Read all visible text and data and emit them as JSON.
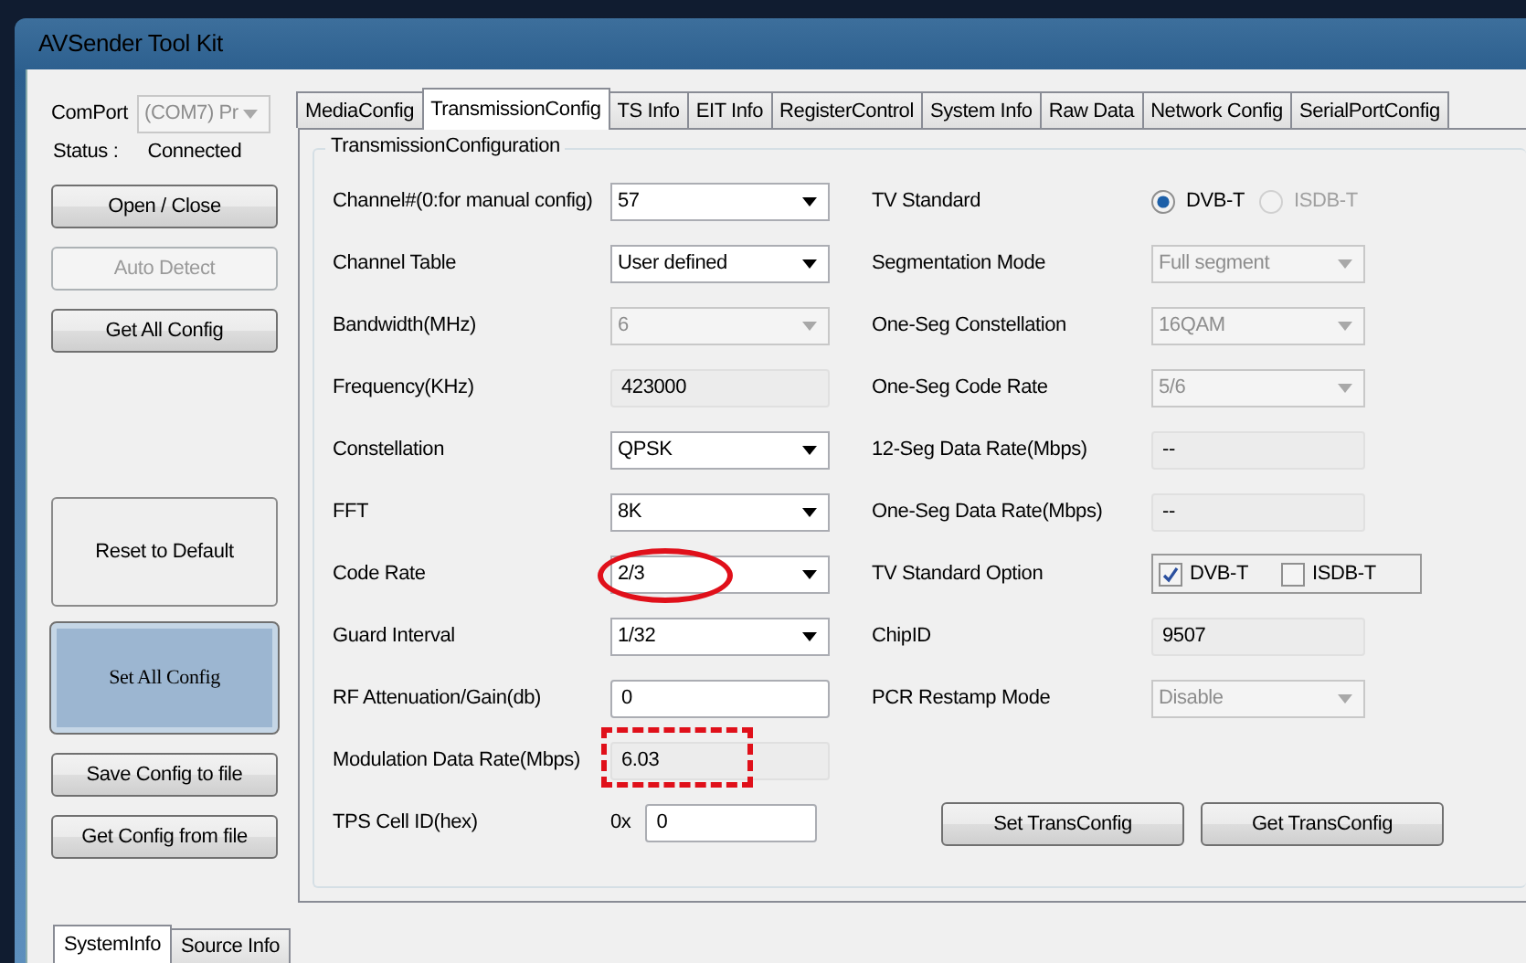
{
  "window": {
    "title": "AVSender Tool Kit"
  },
  "left_panel": {
    "comport_label": "ComPort",
    "comport_value": "(COM7) Pr",
    "comport_disabled": true,
    "status_label": "Status :",
    "status_value": "Connected",
    "buttons": [
      {
        "label": "Open / Close",
        "kind": "normal",
        "disabled": false,
        "highlighted": false
      },
      {
        "label": "Auto Detect",
        "kind": "normal",
        "disabled": true,
        "highlighted": false
      },
      {
        "label": "Get All Config",
        "kind": "normal",
        "disabled": false,
        "highlighted": false
      },
      {
        "label": "Reset to Default",
        "kind": "tall",
        "disabled": false,
        "highlighted": false
      },
      {
        "label": "Set All Config",
        "kind": "tall",
        "disabled": false,
        "highlighted": true
      },
      {
        "label": "Save Config to file",
        "kind": "normal",
        "disabled": false,
        "highlighted": false
      },
      {
        "label": "Get Config from file",
        "kind": "normal",
        "disabled": false,
        "highlighted": false
      }
    ]
  },
  "tabs": [
    {
      "label": "MediaConfig",
      "selected": false
    },
    {
      "label": "TransmissionConfig",
      "selected": true
    },
    {
      "label": "TS Info",
      "selected": false
    },
    {
      "label": "EIT Info",
      "selected": false
    },
    {
      "label": "RegisterControl",
      "selected": false
    },
    {
      "label": "System Info",
      "selected": false
    },
    {
      "label": "Raw Data",
      "selected": false
    },
    {
      "label": "Network Config",
      "selected": false
    },
    {
      "label": "SerialPortConfig",
      "selected": false
    }
  ],
  "group": {
    "title": "TransmissionConfiguration",
    "left_rows": [
      {
        "label": "Channel#(0:for manual config)",
        "kind": "dropdown",
        "value": "57",
        "disabled": false
      },
      {
        "label": "Channel Table",
        "kind": "dropdown",
        "value": "User defined",
        "disabled": false
      },
      {
        "label": "Bandwidth(MHz)",
        "kind": "dropdown",
        "value": "6",
        "disabled": true
      },
      {
        "label": "Frequency(KHz)",
        "kind": "text",
        "value": "423000",
        "disabled": true
      },
      {
        "label": "Constellation",
        "kind": "dropdown",
        "value": "QPSK",
        "disabled": false
      },
      {
        "label": "FFT",
        "kind": "dropdown",
        "value": "8K",
        "disabled": false
      },
      {
        "label": "Code Rate",
        "kind": "dropdown",
        "value": "2/3",
        "disabled": false,
        "circled": true
      },
      {
        "label": "Guard Interval",
        "kind": "dropdown",
        "value": "1/32",
        "disabled": false
      },
      {
        "label": "RF Attenuation/Gain(db)",
        "kind": "text",
        "value": "0",
        "disabled": false
      },
      {
        "label": "Modulation Data Rate(Mbps)",
        "kind": "text",
        "value": "6.03",
        "disabled": true,
        "dash_boxed": true
      },
      {
        "label": "TPS Cell ID(hex)",
        "kind": "prefixed",
        "prefix": "0x",
        "value": "0",
        "disabled": false
      }
    ],
    "right_rows": [
      {
        "label": "TV Standard",
        "kind": "radio",
        "options": [
          {
            "label": "DVB-T",
            "selected": true,
            "disabled": false
          },
          {
            "label": "ISDB-T",
            "selected": false,
            "disabled": true
          }
        ]
      },
      {
        "label": "Segmentation Mode",
        "kind": "dropdown",
        "value": "Full segment",
        "disabled": true
      },
      {
        "label": "One-Seg Constellation",
        "kind": "dropdown",
        "value": "16QAM",
        "disabled": true
      },
      {
        "label": "One-Seg Code Rate",
        "kind": "dropdown",
        "value": "5/6",
        "disabled": true
      },
      {
        "label": "12-Seg Data Rate(Mbps)",
        "kind": "text",
        "value": "--",
        "disabled": true
      },
      {
        "label": "One-Seg Data Rate(Mbps)",
        "kind": "text",
        "value": "--",
        "disabled": true
      },
      {
        "label": "TV Standard Option",
        "kind": "checkboxes",
        "options": [
          {
            "label": "DVB-T",
            "checked": true
          },
          {
            "label": "ISDB-T",
            "checked": false
          }
        ]
      },
      {
        "label": "ChipID",
        "kind": "text",
        "value": "9507",
        "disabled": true
      },
      {
        "label": "PCR Restamp Mode",
        "kind": "dropdown",
        "value": "Disable",
        "disabled": true
      }
    ],
    "buttons": [
      "Set TransConfig",
      "Get TransConfig"
    ]
  },
  "bottom_tabs": [
    {
      "label": "SystemInfo",
      "selected": true
    },
    {
      "label": "Source Info",
      "selected": false
    }
  ]
}
